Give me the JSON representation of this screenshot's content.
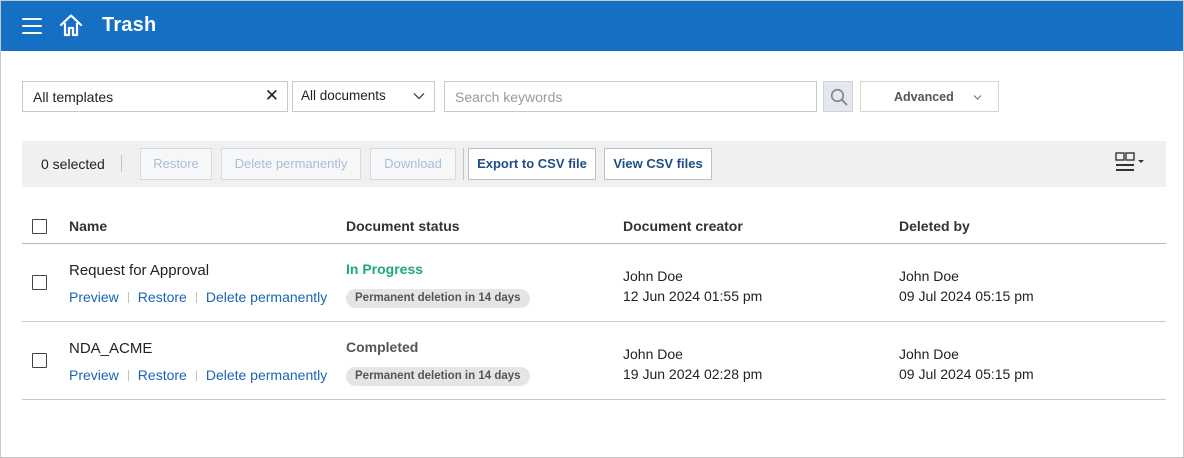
{
  "header": {
    "title": "Trash",
    "background": "#1570c4"
  },
  "filters": {
    "template_value": "All templates",
    "clear_symbol": "✕",
    "documents_value": "All documents",
    "search_placeholder": "Search keywords",
    "advanced_label": "Advanced"
  },
  "toolbar": {
    "selected_count": "0 selected",
    "restore": "Restore",
    "delete_permanently": "Delete permanently",
    "download": "Download",
    "export_csv": "Export to CSV file",
    "view_csv": "View CSV files"
  },
  "table": {
    "columns": [
      "Name",
      "Document status",
      "Document creator",
      "Deleted by"
    ],
    "rows": [
      {
        "name": "Request for Approval",
        "actions": [
          "Preview",
          "Restore",
          "Delete permanently"
        ],
        "status": "In Progress",
        "status_color": "#1ea882",
        "deletion_note": "Permanent deletion in 14 days",
        "creator": "John Doe",
        "created_at": "12 Jun 2024 01:55 pm",
        "deleted_by": "John Doe",
        "deleted_at": "09 Jul 2024 05:15 pm"
      },
      {
        "name": "NDA_ACME",
        "actions": [
          "Preview",
          "Restore",
          "Delete permanently"
        ],
        "status": "Completed",
        "status_color": "#555555",
        "deletion_note": "Permanent deletion in 14 days",
        "creator": "John Doe",
        "created_at": "19 Jun 2024 02:28 pm",
        "deleted_by": "John Doe",
        "deleted_at": "09 Jul 2024 05:15 pm"
      }
    ]
  },
  "icons": {
    "menu": "hamburger-menu-icon",
    "home": "home-icon",
    "clear": "close-icon",
    "dropdown": "chevron-down-icon",
    "search": "search-icon",
    "view_toggle": "grid-view-icon"
  }
}
